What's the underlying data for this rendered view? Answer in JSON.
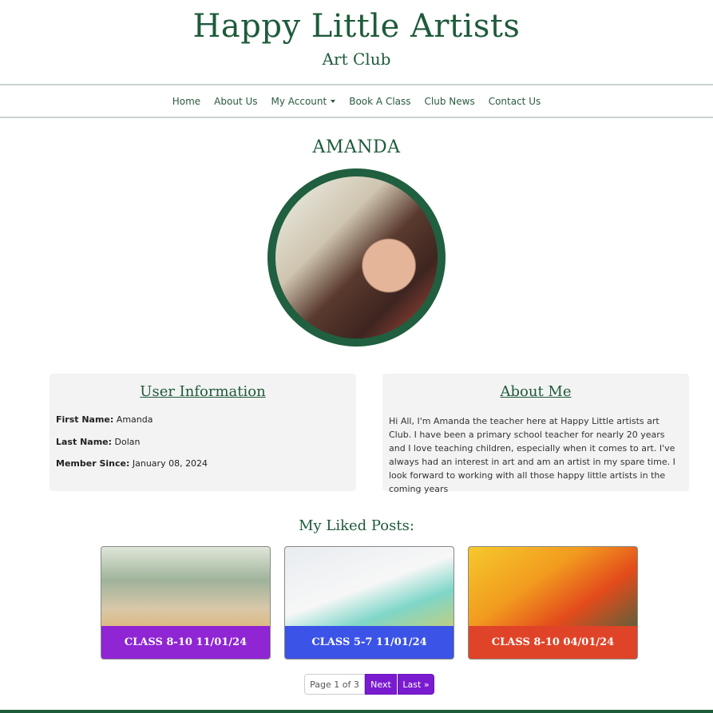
{
  "header": {
    "title": "Happy Little Artists",
    "subtitle": "Art Club"
  },
  "nav": {
    "items": [
      "Home",
      "About Us",
      "My Account",
      "Book A Class",
      "Club News",
      "Contact Us"
    ]
  },
  "profile": {
    "name": "AMANDA"
  },
  "user_info": {
    "heading": "User Information",
    "first_name_label": "First Name:",
    "first_name": "Amanda",
    "last_name_label": "Last Name:",
    "last_name": "Dolan",
    "member_since_label": "Member Since:",
    "member_since": "January 08, 2024"
  },
  "about": {
    "heading": "About Me",
    "text": "Hi All, I'm Amanda the teacher here at Happy Little artists art Club. I have been a primary school teacher for nearly 20 years and I love teaching children, especially when it comes to art. I've always had an interest in art and am an artist in my spare time. I look forward to working with all those happy little artists in the coming years"
  },
  "liked_posts": {
    "title": "My Liked Posts:",
    "items": [
      {
        "label": "CLASS 8-10 11/01/24",
        "color": "#8f25d3"
      },
      {
        "label": "CLASS 5-7 11/01/24",
        "color": "#3b53e6"
      },
      {
        "label": "CLASS 8-10 04/01/24",
        "color": "#e04428"
      }
    ]
  },
  "pagination": {
    "indicator": "Page 1 of 3",
    "next": "Next",
    "last": "Last »"
  },
  "colors": {
    "brand_green": "#1e5b3a",
    "button_purple": "#7a1bd0"
  }
}
